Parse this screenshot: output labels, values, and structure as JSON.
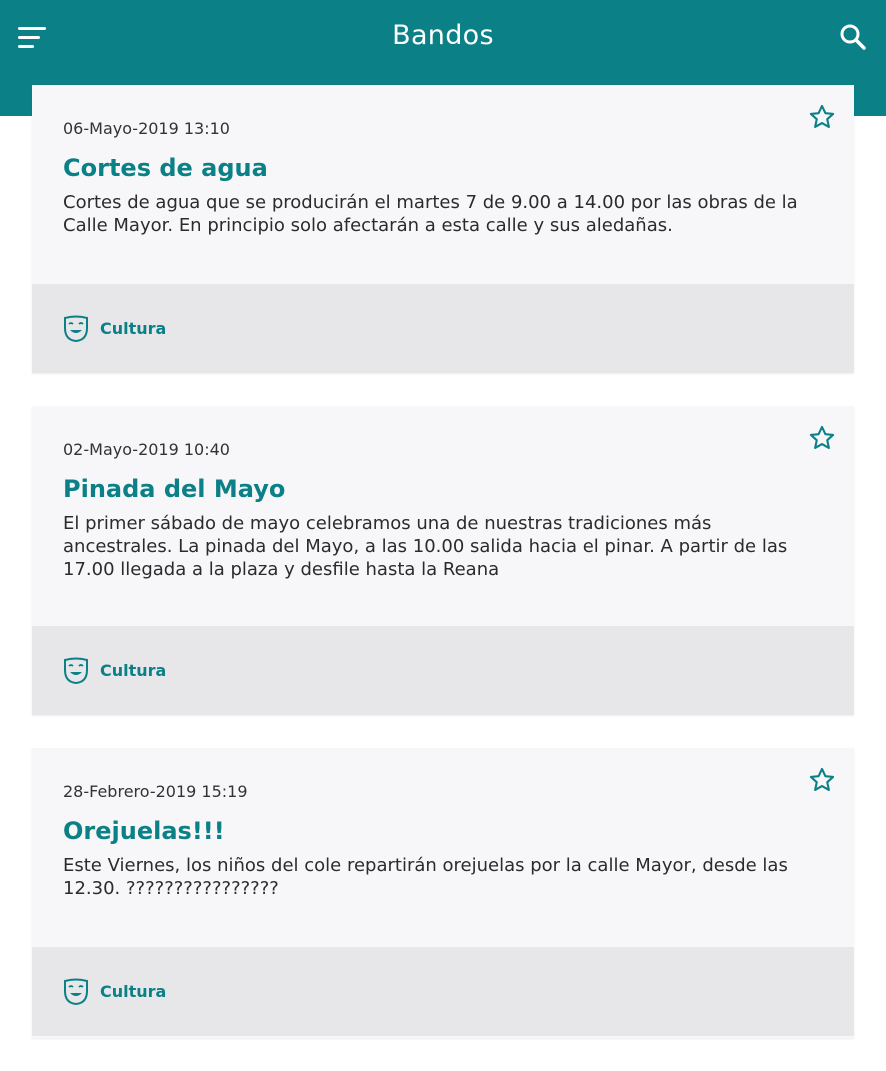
{
  "app_bar": {
    "title": "Bandos",
    "menu_icon": "hamburger-menu-icon",
    "search_icon": "search-icon",
    "background": "#0b8086"
  },
  "colors": {
    "accent": "#0b8086",
    "card_background": "#f7f7f9",
    "footer_background": "#e7e7ea"
  },
  "announcements": [
    {
      "date": "06-Mayo-2019 13:10",
      "title": "Cortes de agua",
      "description": "Cortes de agua que se producirán el martes 7 de 9.00 a 14.00 por las obras de la Calle Mayor. En principio solo afectarán a esta calle y sus aledañas.",
      "category": "Cultura",
      "category_icon": "theater-mask-icon",
      "favorite_icon": "star-outline-icon"
    },
    {
      "date": "02-Mayo-2019 10:40",
      "title": "Pinada del Mayo",
      "description": "El primer sábado de mayo celebramos una de nuestras tradiciones más ancestrales. La pinada del Mayo, a las 10.00 salida hacia el pinar. A partir de las 17.00 llegada a la plaza y desfile hasta la Reana",
      "category": "Cultura",
      "category_icon": "theater-mask-icon",
      "favorite_icon": "star-outline-icon"
    },
    {
      "date": "28-Febrero-2019 15:19",
      "title": "Orejuelas!!!",
      "description": "Este Viernes, los niños del cole repartirán orejuelas por la calle Mayor, desde las 12.30. ????????????????",
      "category": "Cultura",
      "category_icon": "theater-mask-icon",
      "favorite_icon": "star-outline-icon"
    }
  ]
}
